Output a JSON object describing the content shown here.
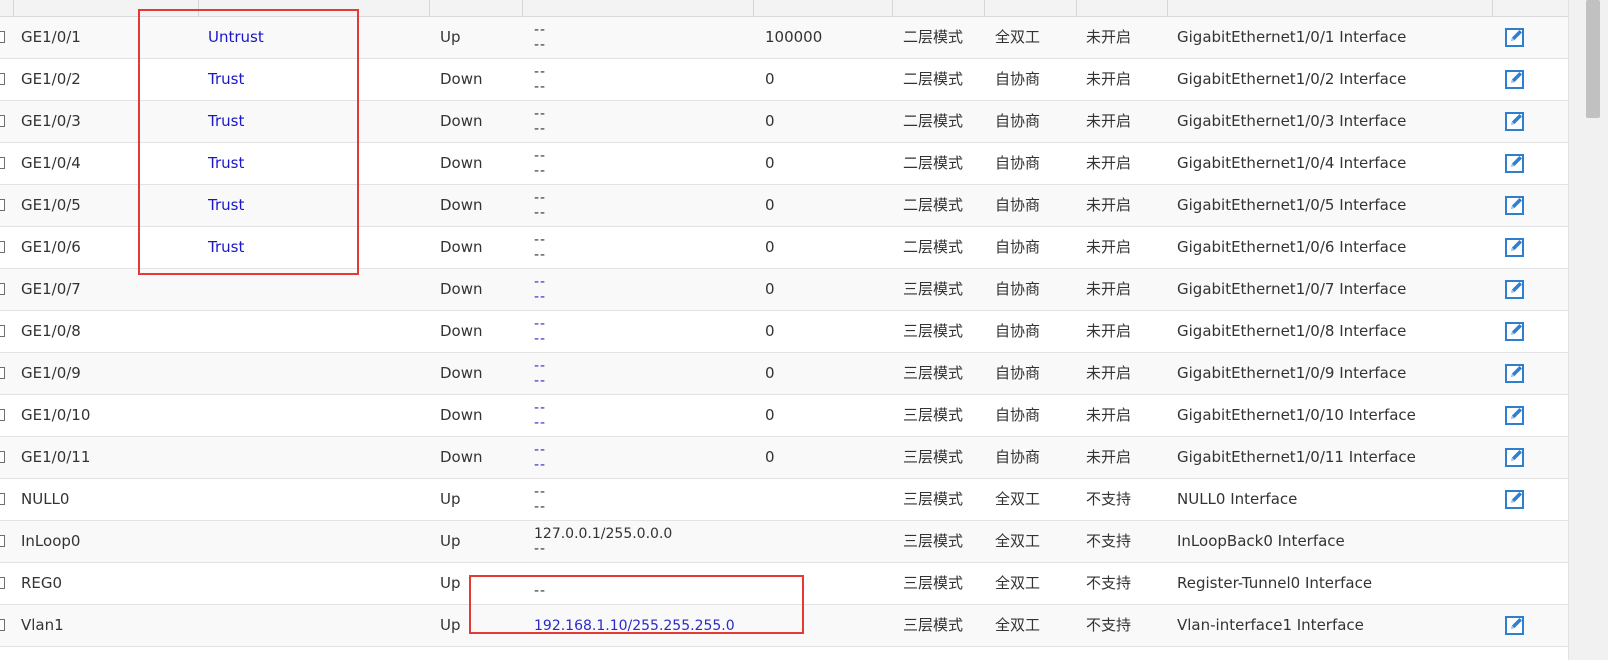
{
  "colors": {
    "zone_link": "#1a16c9",
    "ip_link": "#2a2ac8",
    "highlight_box": "#e53935",
    "edit_icon": "#2f7fd1"
  },
  "rows": [
    {
      "name": "GE1/0/1",
      "zone": "Untrust",
      "state": "Up",
      "ip1": "--",
      "ip2": "--",
      "ip_link": false,
      "rate": "100000",
      "mode": "二层模式",
      "duplex": "全双工",
      "ratelimit": "未开启",
      "desc": "GigabitEthernet1/0/1 Interface",
      "editable": true
    },
    {
      "name": "GE1/0/2",
      "zone": "Trust",
      "state": "Down",
      "ip1": "--",
      "ip2": "--",
      "ip_link": false,
      "rate": "0",
      "mode": "二层模式",
      "duplex": "自协商",
      "ratelimit": "未开启",
      "desc": "GigabitEthernet1/0/2 Interface",
      "editable": true
    },
    {
      "name": "GE1/0/3",
      "zone": "Trust",
      "state": "Down",
      "ip1": "--",
      "ip2": "--",
      "ip_link": false,
      "rate": "0",
      "mode": "二层模式",
      "duplex": "自协商",
      "ratelimit": "未开启",
      "desc": "GigabitEthernet1/0/3 Interface",
      "editable": true
    },
    {
      "name": "GE1/0/4",
      "zone": "Trust",
      "state": "Down",
      "ip1": "--",
      "ip2": "--",
      "ip_link": false,
      "rate": "0",
      "mode": "二层模式",
      "duplex": "自协商",
      "ratelimit": "未开启",
      "desc": "GigabitEthernet1/0/4 Interface",
      "editable": true
    },
    {
      "name": "GE1/0/5",
      "zone": "Trust",
      "state": "Down",
      "ip1": "--",
      "ip2": "--",
      "ip_link": false,
      "rate": "0",
      "mode": "二层模式",
      "duplex": "自协商",
      "ratelimit": "未开启",
      "desc": "GigabitEthernet1/0/5 Interface",
      "editable": true
    },
    {
      "name": "GE1/0/6",
      "zone": "Trust",
      "state": "Down",
      "ip1": "--",
      "ip2": "--",
      "ip_link": false,
      "rate": "0",
      "mode": "二层模式",
      "duplex": "自协商",
      "ratelimit": "未开启",
      "desc": "GigabitEthernet1/0/6 Interface",
      "editable": true
    },
    {
      "name": "GE1/0/7",
      "zone": "",
      "state": "Down",
      "ip1": "--",
      "ip2": "--",
      "ip_link": true,
      "rate": "0",
      "mode": "三层模式",
      "duplex": "自协商",
      "ratelimit": "未开启",
      "desc": "GigabitEthernet1/0/7 Interface",
      "editable": true
    },
    {
      "name": "GE1/0/8",
      "zone": "",
      "state": "Down",
      "ip1": "--",
      "ip2": "--",
      "ip_link": true,
      "rate": "0",
      "mode": "三层模式",
      "duplex": "自协商",
      "ratelimit": "未开启",
      "desc": "GigabitEthernet1/0/8 Interface",
      "editable": true
    },
    {
      "name": "GE1/0/9",
      "zone": "",
      "state": "Down",
      "ip1": "--",
      "ip2": "--",
      "ip_link": true,
      "rate": "0",
      "mode": "三层模式",
      "duplex": "自协商",
      "ratelimit": "未开启",
      "desc": "GigabitEthernet1/0/9 Interface",
      "editable": true
    },
    {
      "name": "GE1/0/10",
      "zone": "",
      "state": "Down",
      "ip1": "--",
      "ip2": "--",
      "ip_link": true,
      "rate": "0",
      "mode": "三层模式",
      "duplex": "自协商",
      "ratelimit": "未开启",
      "desc": "GigabitEthernet1/0/10 Interface",
      "editable": true
    },
    {
      "name": "GE1/0/11",
      "zone": "",
      "state": "Down",
      "ip1": "--",
      "ip2": "--",
      "ip_link": true,
      "rate": "0",
      "mode": "三层模式",
      "duplex": "自协商",
      "ratelimit": "未开启",
      "desc": "GigabitEthernet1/0/11 Interface",
      "editable": true
    },
    {
      "name": "NULL0",
      "zone": "",
      "state": "Up",
      "ip1": "--",
      "ip2": "--",
      "ip_link": false,
      "rate": "",
      "mode": "三层模式",
      "duplex": "全双工",
      "ratelimit": "不支持",
      "desc": "NULL0 Interface",
      "editable": true
    },
    {
      "name": "InLoop0",
      "zone": "",
      "state": "Up",
      "ip1": "127.0.0.1/255.0.0.0",
      "ip2": "--",
      "ip_link": false,
      "rate": "",
      "mode": "三层模式",
      "duplex": "全双工",
      "ratelimit": "不支持",
      "desc": "InLoopBack0 Interface",
      "editable": false
    },
    {
      "name": "REG0",
      "zone": "",
      "state": "Up",
      "ip1": "--",
      "ip2": "--",
      "ip_link": false,
      "rate": "",
      "mode": "三层模式",
      "duplex": "全双工",
      "ratelimit": "不支持",
      "desc": "Register-Tunnel0 Interface",
      "editable": false
    },
    {
      "name": "Vlan1",
      "zone": "",
      "state": "Up",
      "ip1": "192.168.1.10/255.255.255.0",
      "ip2": "",
      "ip_link": true,
      "rate": "",
      "mode": "三层模式",
      "duplex": "全双工",
      "ratelimit": "不支持",
      "desc": "Vlan-interface1 Interface",
      "editable": true
    }
  ]
}
